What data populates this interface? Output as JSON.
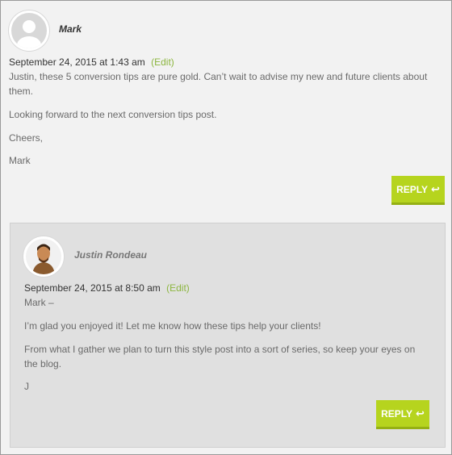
{
  "comment": {
    "author": "Mark",
    "date": "September 24, 2015 at 1:43 am",
    "edit_label": "(Edit)",
    "paragraphs": [
      "Justin, these 5 conversion tips are pure gold. Can’t wait to advise my new and future clients about them.",
      "Looking forward to the next conversion tips post.",
      "Cheers,",
      "Mark"
    ],
    "reply_label": "REPLY",
    "reply_icon": "reply-arrow-icon"
  },
  "reply": {
    "author": "Justin Rondeau",
    "date": "September 24, 2015 at 8:50 am",
    "edit_label": "(Edit)",
    "paragraphs": [
      "Mark –",
      "I’m glad you enjoyed it! Let me know how these tips help your clients!",
      "From what I gather we plan to turn this style post into a sort of series, so keep your eyes on the blog.",
      "J"
    ],
    "reply_label": "REPLY",
    "reply_icon": "reply-arrow-icon"
  },
  "colors": {
    "accent": "#b6d41e",
    "edit_link": "#8cb63f"
  }
}
